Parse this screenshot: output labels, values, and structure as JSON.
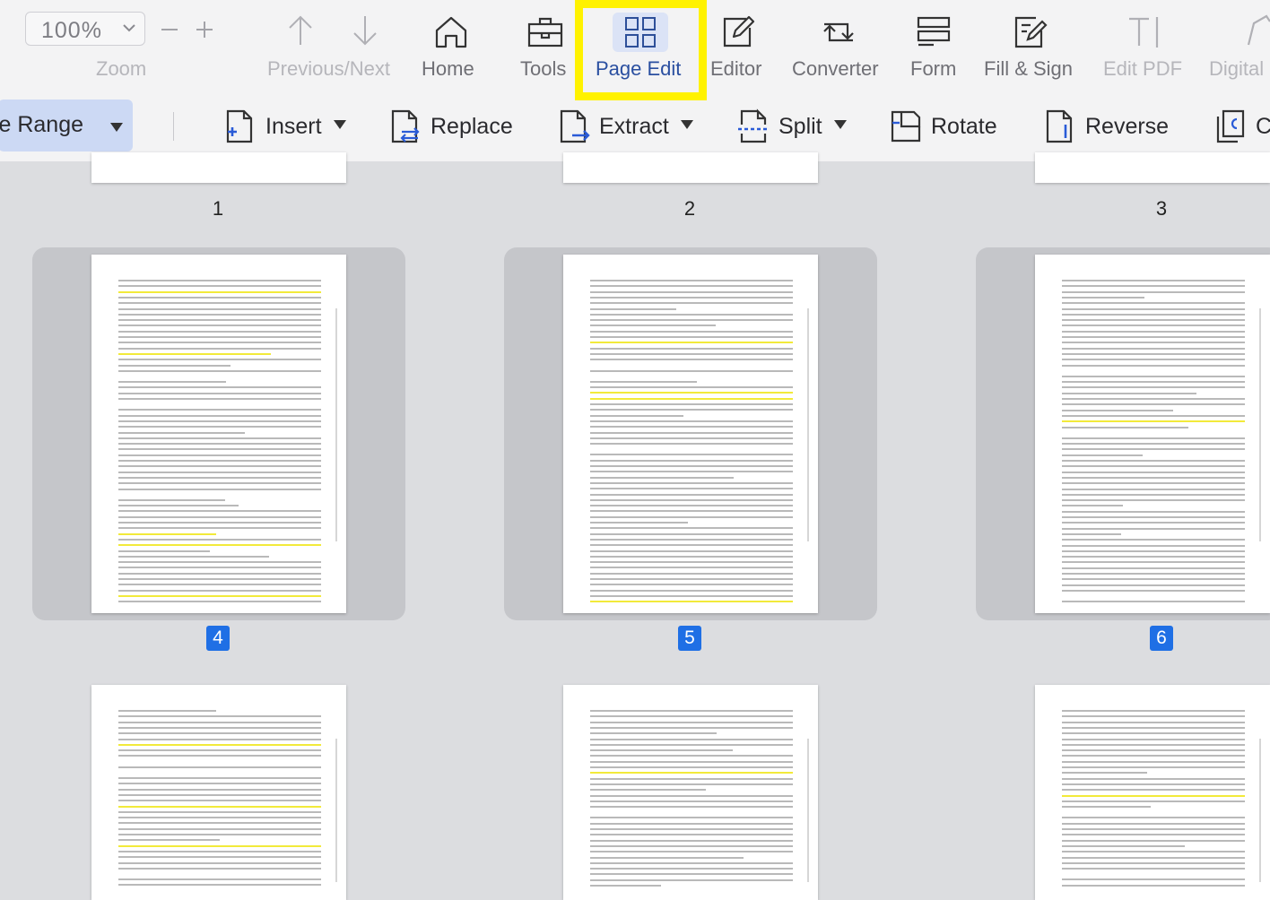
{
  "toolbar": {
    "zoom": {
      "value": "100%",
      "label": "Zoom"
    },
    "tools": [
      {
        "key": "prevnext",
        "label": "Previous/Next",
        "icon": "up-down-arrows-icon",
        "disabled": true
      },
      {
        "key": "home",
        "label": "Home",
        "icon": "home-icon"
      },
      {
        "key": "tools",
        "label": "Tools",
        "icon": "toolbox-icon"
      },
      {
        "key": "pageedit",
        "label": "Page Edit",
        "icon": "page-grid-icon",
        "active": true
      },
      {
        "key": "editor",
        "label": "Editor",
        "icon": "edit-pencil-icon"
      },
      {
        "key": "converter",
        "label": "Converter",
        "icon": "convert-icon"
      },
      {
        "key": "form",
        "label": "Form",
        "icon": "form-icon"
      },
      {
        "key": "fillsign",
        "label": "Fill & Sign",
        "icon": "signature-icon"
      },
      {
        "key": "editpdf",
        "label": "Edit PDF",
        "icon": "text-cursor-icon",
        "disabled": true
      },
      {
        "key": "digital",
        "label": "Digital",
        "icon": "digital-signature-icon",
        "disabled": true
      }
    ],
    "accent": "#1f6fe5",
    "highlight_color": "#fff200"
  },
  "subtoolbar": {
    "page_range": "Page Range",
    "actions": [
      {
        "key": "insert",
        "label": "Insert",
        "icon": "insert-page-icon",
        "dropdown": true
      },
      {
        "key": "replace",
        "label": "Replace",
        "icon": "replace-page-icon",
        "dropdown": false
      },
      {
        "key": "extract",
        "label": "Extract",
        "icon": "extract-page-icon",
        "dropdown": true
      },
      {
        "key": "split",
        "label": "Split",
        "icon": "split-page-icon",
        "dropdown": true
      },
      {
        "key": "rotate",
        "label": "Rotate",
        "icon": "rotate-page-icon",
        "dropdown": false
      },
      {
        "key": "reverse",
        "label": "Reverse",
        "icon": "reverse-page-icon",
        "dropdown": false
      },
      {
        "key": "copy",
        "label": "C",
        "icon": "copy-page-icon",
        "dropdown": false
      }
    ]
  },
  "pages": {
    "row1": [
      "1",
      "2",
      "3"
    ],
    "row2": [
      "4",
      "5",
      "6"
    ]
  }
}
